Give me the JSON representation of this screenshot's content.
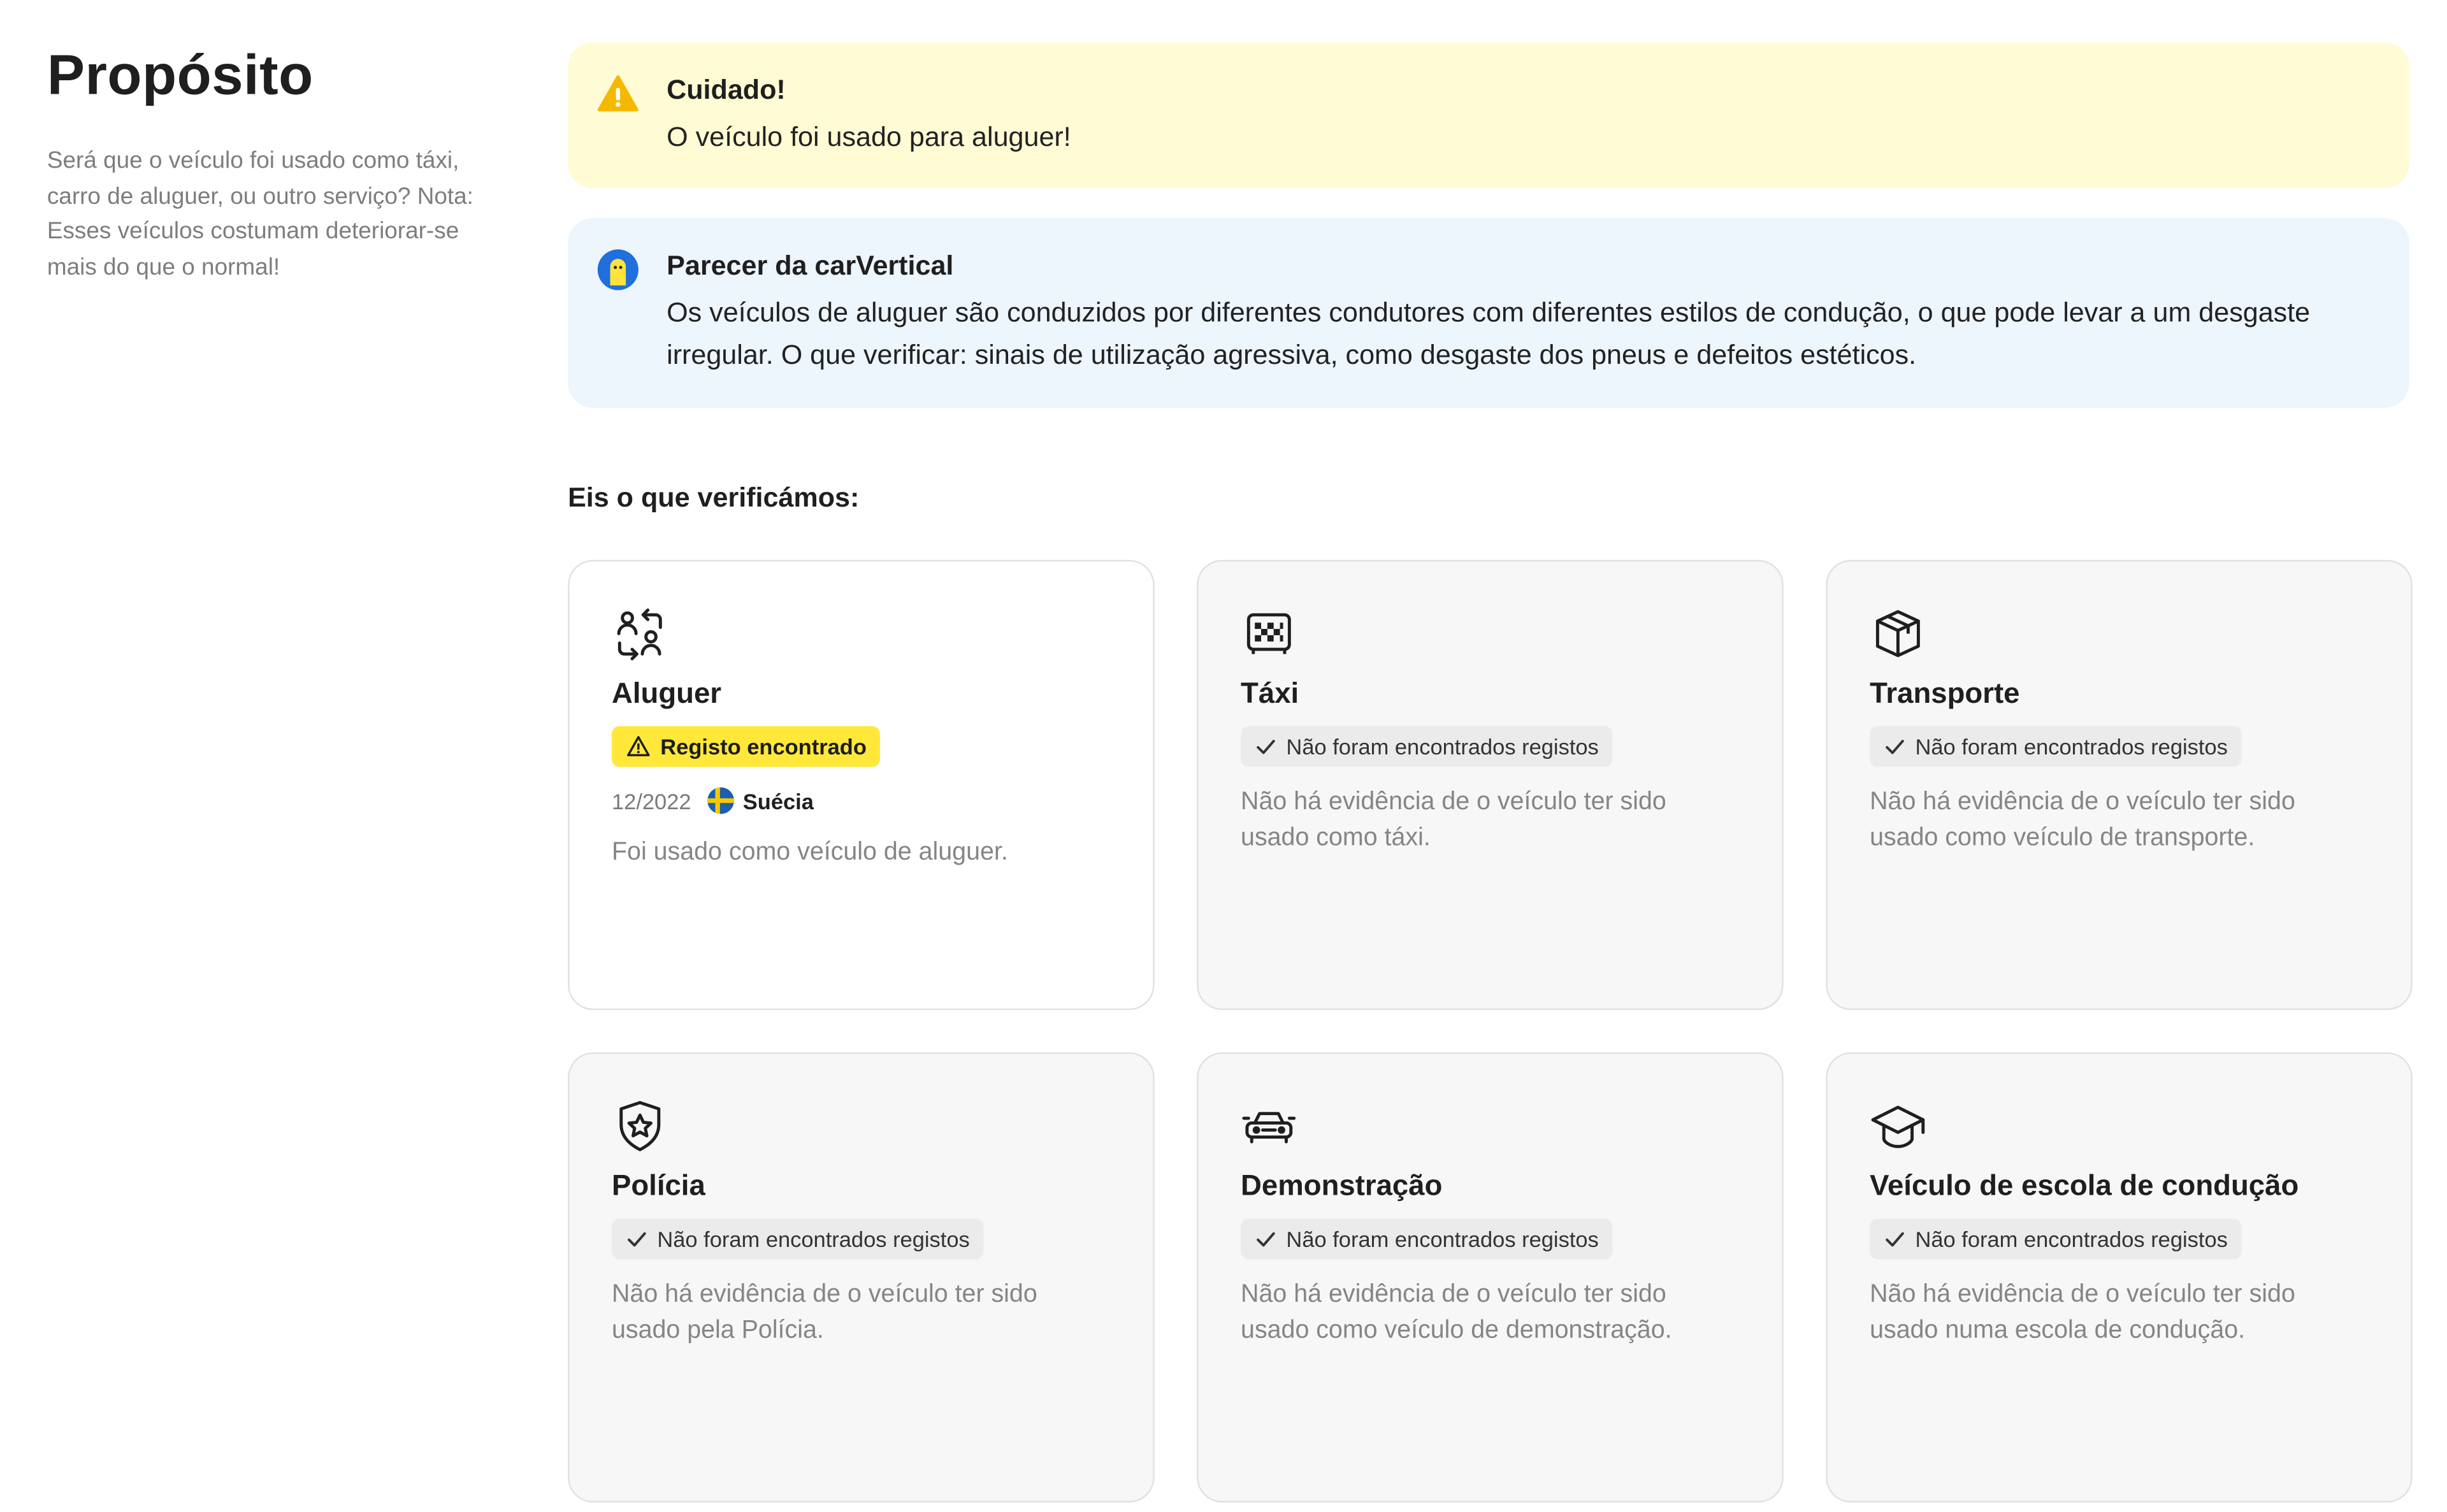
{
  "sidebar": {
    "title": "Propósito",
    "description": "Será que o veículo foi usado como táxi, carro de aluguer, ou outro serviço? Nota: Esses veículos costumam deteriorar-se mais do que o normal!"
  },
  "warning_alert": {
    "title": "Cuidado!",
    "text": "O veículo foi usado para aluguer!",
    "icon": "warning-triangle-icon",
    "color": "#fffbd4"
  },
  "info_alert": {
    "title": "Parecer da carVertical",
    "text": "Os veículos de aluguer são conduzidos por diferentes condutores com diferentes estilos de condução, o que pode levar a um desgaste irregular. O que verificar: sinais de utilização agressiva, como desgaste dos pneus e defeitos estéticos.",
    "icon": "carvertical-mascot-icon",
    "color": "#edf5fd"
  },
  "checks_heading": "Eis o que verificámos:",
  "checks": [
    {
      "title": "Aluguer",
      "icon": "rental-swap-icon",
      "status": "Registo encontrado",
      "found": true,
      "date": "12/2022",
      "country": "Suécia",
      "description": "Foi usado como veículo de aluguer."
    },
    {
      "title": "Táxi",
      "icon": "taxi-icon",
      "status": "Não foram encontrados registos",
      "found": false,
      "description": "Não há evidência de o veículo ter sido usado como táxi."
    },
    {
      "title": "Transporte",
      "icon": "package-box-icon",
      "status": "Não foram encontrados registos",
      "found": false,
      "description": "Não há evidência de o veículo ter sido usado como veículo de transporte."
    },
    {
      "title": "Polícia",
      "icon": "police-shield-icon",
      "status": "Não foram encontrados registos",
      "found": false,
      "description": "Não há evidência de o veículo ter sido usado pela Polícia."
    },
    {
      "title": "Demonstração",
      "icon": "demo-car-icon",
      "status": "Não foram encontrados registos",
      "found": false,
      "description": "Não há evidência de o veículo ter sido usado como veículo de demonstração."
    },
    {
      "title": "Veículo de escola de condução",
      "icon": "graduation-cap-icon",
      "status": "Não foram encontrados registos",
      "found": false,
      "description": "Não há evidência de o veículo ter sido usado numa escola de condução."
    }
  ],
  "colors": {
    "warn_badge": "#ffe83a",
    "ok_badge": "#ebebeb",
    "card_bg": "#f7f7f7"
  }
}
